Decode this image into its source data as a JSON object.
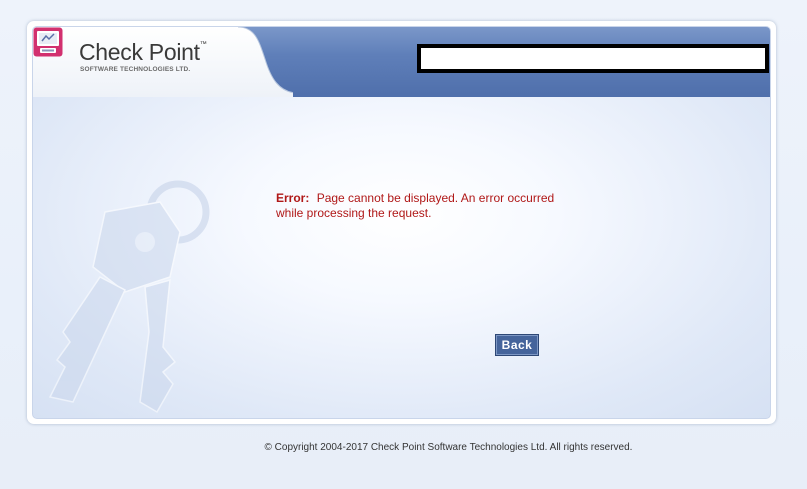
{
  "header": {
    "logo_title": "Check Point",
    "logo_tm": "™",
    "logo_subtitle": "SOFTWARE TECHNOLOGIES LTD."
  },
  "main": {
    "error_label": "Error:",
    "error_text": "Page cannot be displayed. An error occurred while processing the request.",
    "back_label": "Back"
  },
  "footer": {
    "copyright": "© Copyright 2004-2017   Check Point Software Technologies Ltd. All rights reserved."
  },
  "colors": {
    "header_blue": "#5f7fb9",
    "error_red": "#b01818",
    "button_blue": "#45649b"
  },
  "icons": [
    "check-point-logo-icon",
    "key-icon"
  ]
}
